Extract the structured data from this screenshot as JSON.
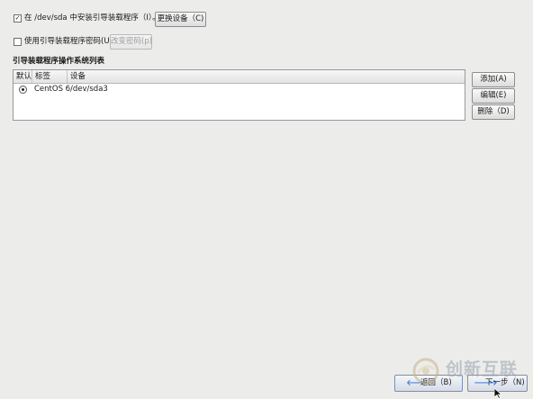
{
  "install_bootloader": {
    "checked": true,
    "check_glyph": "✓",
    "label": "在 /dev/sda 中安装引导装载程序（I）。",
    "change_device_button": "更换设备（C)"
  },
  "bootloader_password": {
    "checked": false,
    "label": "使用引导装载程序密码(U)",
    "change_password_button": "改变密码(p)"
  },
  "os_list": {
    "title": "引导装载程序操作系统列表",
    "columns": [
      "默认",
      "标签",
      "设备"
    ],
    "rows": [
      {
        "default_selected": true,
        "label": "CentOS 6",
        "device": "/dev/sda3"
      }
    ]
  },
  "side_buttons": {
    "add": "添加(A)",
    "edit": "编辑(E)",
    "delete": "删除（D)"
  },
  "nav": {
    "back_label": "返回（B)",
    "next_label": "下一步（N)"
  },
  "watermark": {
    "text": "创新互联",
    "icon": "swirl-logo-icon"
  },
  "colors": {
    "background": "#ececeb",
    "nav_arrow": "#2a6bc4"
  }
}
